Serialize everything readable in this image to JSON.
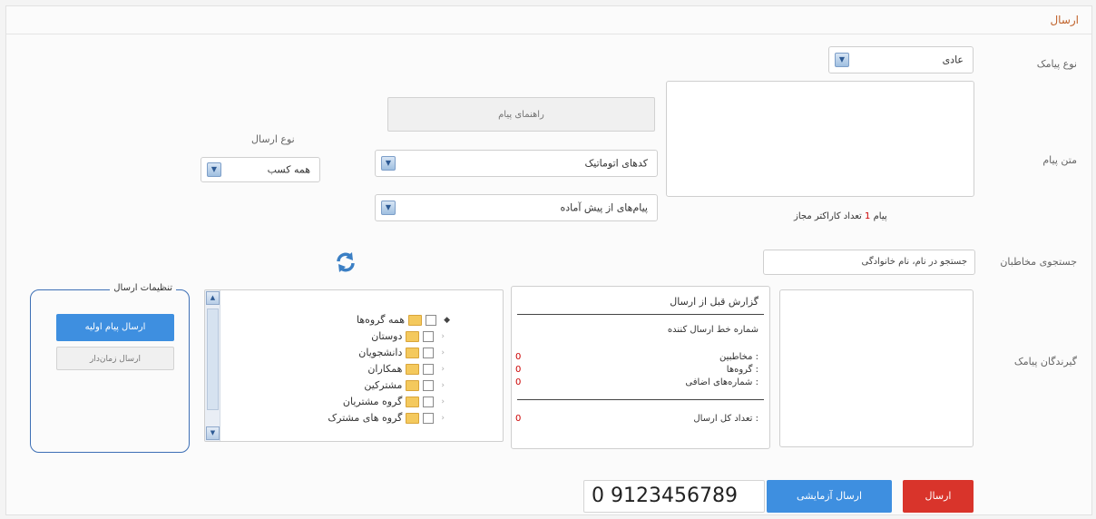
{
  "header": {
    "title": "ارسال"
  },
  "form": {
    "line_label": "نوع پیامک",
    "line_value": "عادی",
    "message_label": "متن پیام",
    "message_placeholder": "",
    "char_counter_prefix": "تعداد کاراکتر مجاز",
    "char_counter_value": "1",
    "char_counter_suffix": "پیام",
    "insert_button": "راهنمای پیام",
    "mobile_dropdown": "کدهای اتوماتیک",
    "field_dropdown": "پیام‌های از پیش آماده",
    "send_type_label": "نوع ارسال",
    "send_type_value": "همه کسب",
    "search_label": "جستجوی مخاطبان",
    "search_value": "جستجو در نام، نام خانوادگی",
    "receivers_label": "گیرندگان پیامک"
  },
  "tree": {
    "items": [
      {
        "label": "همه گروه‌ها"
      },
      {
        "label": "دوستان"
      },
      {
        "label": "دانشجویان"
      },
      {
        "label": "همکاران"
      },
      {
        "label": "مشترکین"
      },
      {
        "label": "گروه مشتریان"
      },
      {
        "label": "گروه های مشترک"
      }
    ]
  },
  "summary": {
    "header": "گزارش قبل از ارسال",
    "line1": "شماره خط ارسال کننده",
    "line2": "مخاطبین :",
    "line3": "گروه‌ها :",
    "line4": "شماره‌های اضافی :",
    "line5": "تعداد کل ارسال :",
    "n2": "0",
    "n3": "0",
    "n4": "0",
    "n5": "0"
  },
  "options": {
    "title": "تنظیمات ارسال",
    "primary": "ارسال پیام اولیه",
    "secondary": "ارسال زمان‌دار"
  },
  "footer": {
    "phone_value": "0 9123456789",
    "test_button": "ارسال آزمایشی",
    "send_button": "ارسال"
  },
  "colors": {
    "accent_blue": "#3e8fe0",
    "send_red": "#d9342b",
    "title_orange": "#c0622a",
    "frame_blue": "#3d6fb5"
  }
}
